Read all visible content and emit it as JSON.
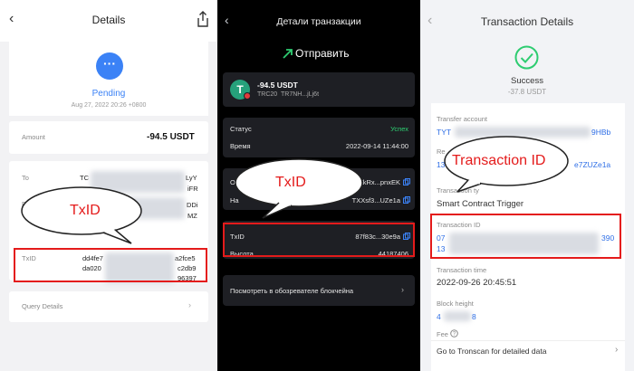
{
  "panel1": {
    "title": "Details",
    "status_icon": "···",
    "status": "Pending",
    "date": "Aug 27, 2022 20:26 +0800",
    "amount_label": "Amount",
    "amount_value": "-94.5 USDT",
    "to_label": "To",
    "to_prefix": "TC",
    "to_tail1": "LyY",
    "to_tail2": "iFR",
    "from_tail1": "DDi",
    "from_tail2": "MZ",
    "txid_label": "TxID",
    "txid_line1_start": "dd4fe7",
    "txid_line1_end": "a2fce5",
    "txid_line2_start": "da020",
    "txid_line2_end": "c2db9",
    "txid_line3_end": "96397",
    "query_details": "Query Details",
    "annotation": "TxID"
  },
  "panel2": {
    "title": "Детали транзакции",
    "send_label": "Отправить",
    "amount": "-94.5 USDT",
    "network": "TRC20",
    "address_short": "TR7NH...jLj6t",
    "status_label": "Статус",
    "status_value": "Успех",
    "time_label": "Время",
    "time_value": "2022-09-14 11:44:00",
    "from_value": "EkRx...pnxEK",
    "to_label": "На",
    "to_value": "TXXsf3...UZe1a",
    "txid_label": "TxID",
    "txid_value": "87f83c...30e9a",
    "height_label": "Высота",
    "height_value": "44187406",
    "explorer_label": "Посмотреть в обозревателе блокчейна",
    "annotation": "TxID"
  },
  "panel3": {
    "title": "Transaction Details",
    "status": "Success",
    "amount": "-37.8 USDT",
    "transfer_account_label": "Transfer account",
    "transfer_account_start": "TYT",
    "transfer_account_end": "9HBb",
    "receive_label_start": "Re",
    "receive_value_start": "13",
    "receive_value_end": "e7ZUZe1a",
    "type_label_start": "Transaction ty",
    "type_value": "Smart Contract Trigger",
    "txid_label": "Transaction ID",
    "txid_line1_start": "07",
    "txid_line1_end": "390",
    "txid_line2_start": "13",
    "time_label": "Transaction time",
    "time_value": "2022-09-26 20:45:51",
    "height_label": "Block height",
    "height_start": "4",
    "height_end": "8",
    "fee_label": "Fee",
    "tronscan_link": "Go to Tronscan for detailed data",
    "annotation": "Transaction ID"
  },
  "colors": {
    "annotation_red": "#e41b1b",
    "pending_blue": "#3b82f6",
    "success_green": "#2ecc71",
    "link_blue": "#2f6fe6",
    "tether_green": "#26a17b"
  },
  "icons": [
    "back-arrow-icon",
    "share-icon",
    "more-dots-icon",
    "send-icon",
    "tether-icon",
    "copy-icon",
    "chevron-right-icon",
    "check-circle-icon",
    "help-icon"
  ]
}
